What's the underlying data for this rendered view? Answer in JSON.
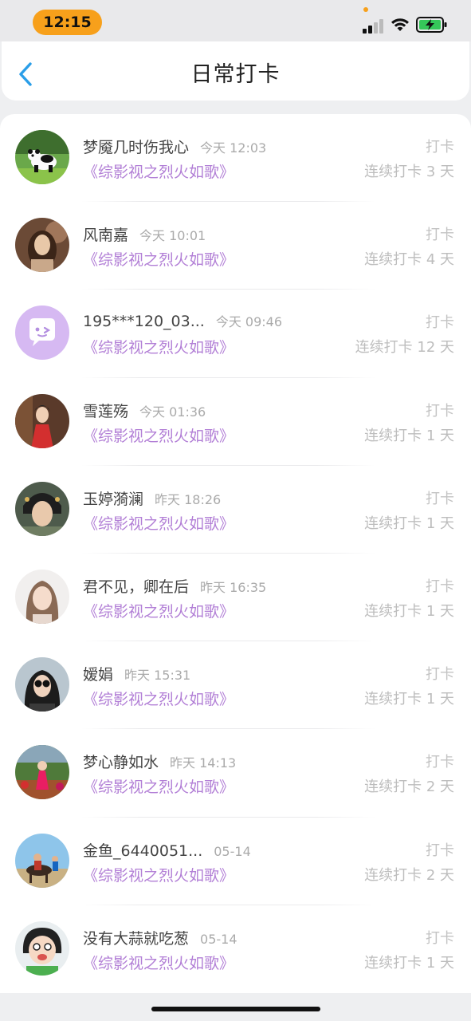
{
  "status_bar": {
    "time": "12:15",
    "accent_color": "#f7a01b"
  },
  "header": {
    "title": "日常打卡",
    "back_icon": "chevron-left-icon",
    "back_color": "#2a9ee8"
  },
  "list": {
    "items": [
      {
        "name": "梦魇几时伤我心",
        "time": "今天 12:03",
        "book": "《综影视之烈火如歌》",
        "checkin_label": "打卡",
        "streak": "连续打卡 3 天",
        "avatar": "panda-photo"
      },
      {
        "name": "风南嘉",
        "time": "今天 10:01",
        "book": "《综影视之烈火如歌》",
        "checkin_label": "打卡",
        "streak": "连续打卡 4 天",
        "avatar": "portrait-photo"
      },
      {
        "name": "195***120_03...",
        "time": "今天 09:46",
        "book": "《综影视之烈火如歌》",
        "checkin_label": "打卡",
        "streak": "连续打卡 12 天",
        "avatar": "default-chat-avatar"
      },
      {
        "name": "雪莲殇",
        "time": "今天 01:36",
        "book": "《综影视之烈火如歌》",
        "checkin_label": "打卡",
        "streak": "连续打卡 1 天",
        "avatar": "red-dress-photo"
      },
      {
        "name": "玉婷漪澜",
        "time": "昨天 18:26",
        "book": "《综影视之烈火如歌》",
        "checkin_label": "打卡",
        "streak": "连续打卡 1 天",
        "avatar": "costume-photo"
      },
      {
        "name": "君不见，卿在后",
        "time": "昨天 16:35",
        "book": "《综影视之烈火如歌》",
        "checkin_label": "打卡",
        "streak": "连续打卡 1 天",
        "avatar": "selfie-photo"
      },
      {
        "name": "嫒娟",
        "time": "昨天 15:31",
        "book": "《综影视之烈火如歌》",
        "checkin_label": "打卡",
        "streak": "连续打卡 1 天",
        "avatar": "sunglasses-photo"
      },
      {
        "name": "梦心静如水",
        "time": "昨天 14:13",
        "book": "《综影视之烈火如歌》",
        "checkin_label": "打卡",
        "streak": "连续打卡 2 天",
        "avatar": "garden-photo"
      },
      {
        "name": "金鱼_6440051...",
        "time": "05-14",
        "book": "《综影视之烈火如歌》",
        "checkin_label": "打卡",
        "streak": "连续打卡 2 天",
        "avatar": "horse-photo"
      },
      {
        "name": "没有大蒜就吃葱",
        "time": "05-14",
        "book": "《综影视之烈火如歌》",
        "checkin_label": "打卡",
        "streak": "连续打卡 1 天",
        "avatar": "cartoon-photo"
      }
    ]
  },
  "colors": {
    "book_title": "#b27fd6",
    "muted": "#aaaaaa"
  }
}
